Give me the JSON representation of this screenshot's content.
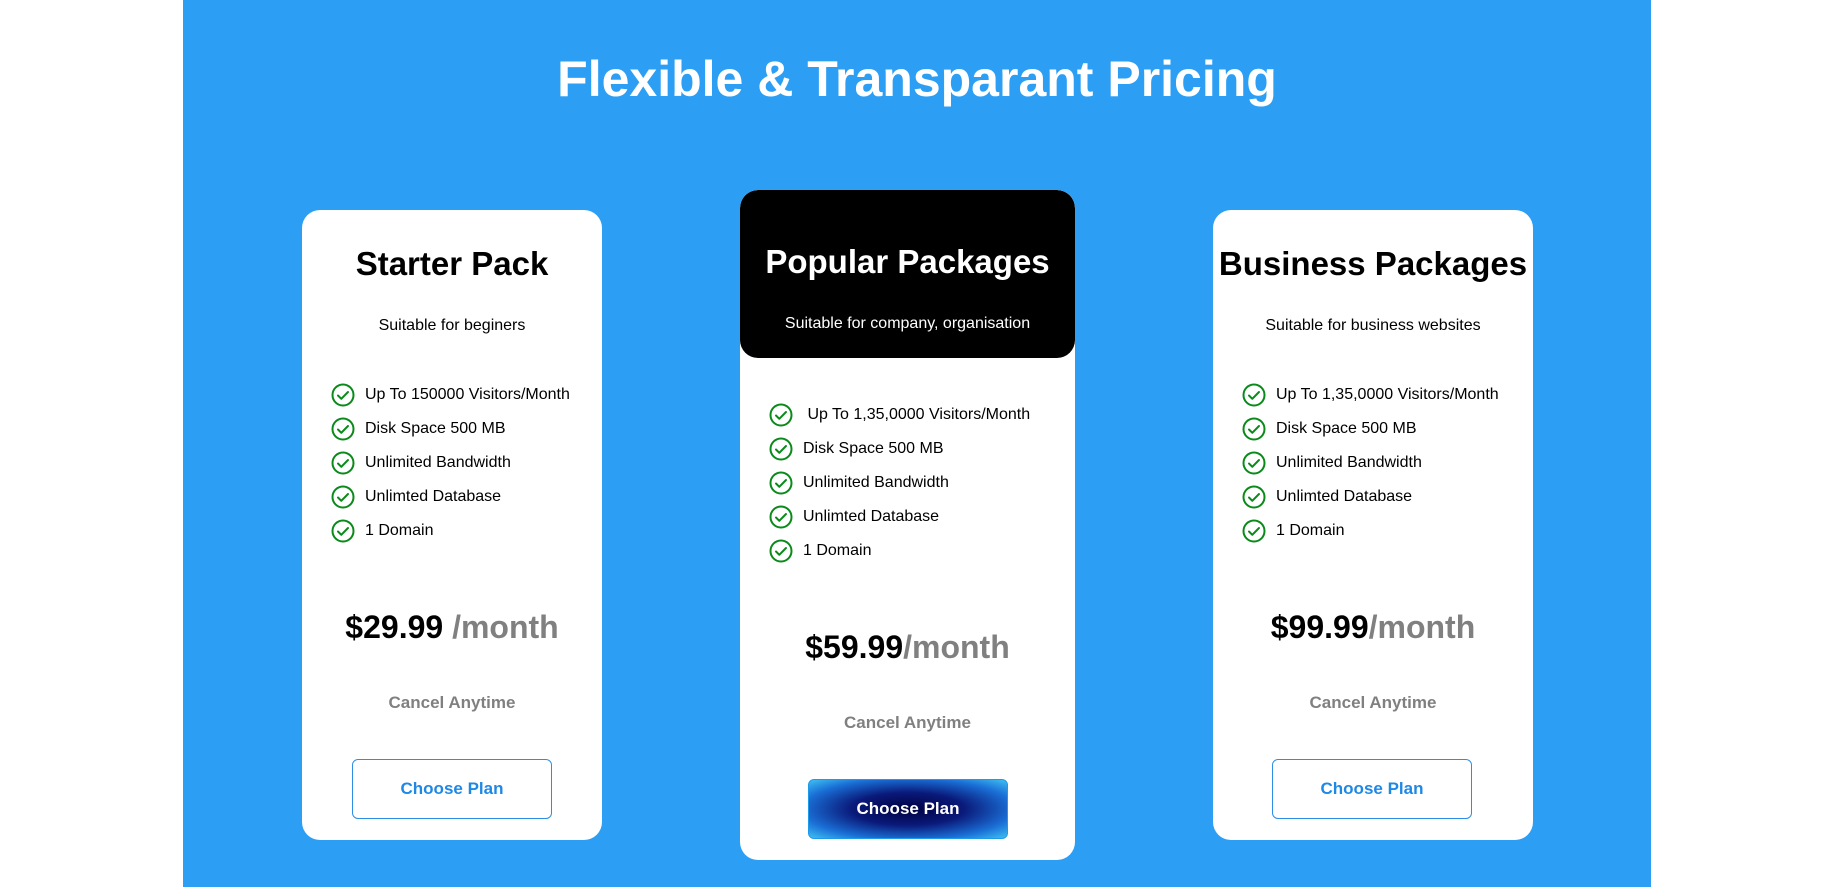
{
  "page": {
    "title": "Flexible & Transparant Pricing"
  },
  "colors": {
    "section_background": "#2c9ff5",
    "check_green": "#0a8a1a",
    "button_blue": "#1e88e5",
    "featured_header": "#000000"
  },
  "icons": {
    "feature": "check-circle-icon"
  },
  "plans": [
    {
      "name": "Starter Pack",
      "subtitle": "Suitable for beginers",
      "features": [
        "Up To 150000 Visitors/Month",
        "Disk Space 500 MB",
        "Unlimited Bandwidth",
        "Unlimted Database",
        "1 Domain"
      ],
      "price": "$29.99",
      "period": " /month",
      "note": "Cancel Anytime",
      "button_label": "Choose Plan"
    },
    {
      "name": "Popular Packages",
      "subtitle": "Suitable for company, organisation",
      "features": [
        " Up To 1,35,0000 Visitors/Month",
        "Disk Space 500 MB",
        "Unlimited Bandwidth",
        "Unlimted Database",
        "1 Domain"
      ],
      "price": "$59.99",
      "period": "/month",
      "note": "Cancel Anytime",
      "button_label": "Choose Plan"
    },
    {
      "name": "Business Packages",
      "subtitle": "Suitable for business websites",
      "features": [
        "Up To 1,35,0000 Visitors/Month",
        "Disk Space 500 MB",
        "Unlimited Bandwidth",
        "Unlimted Database",
        "1 Domain"
      ],
      "price": "$99.99",
      "period": "/month",
      "note": "Cancel Anytime",
      "button_label": "Choose Plan"
    }
  ]
}
